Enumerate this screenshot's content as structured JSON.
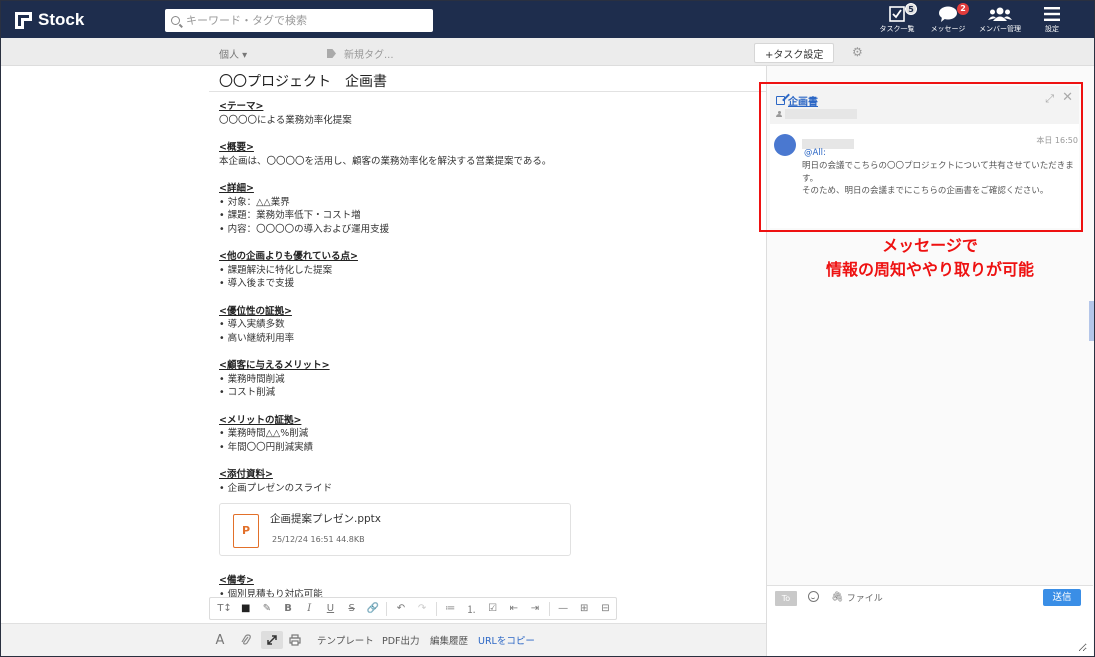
{
  "header": {
    "app_name": "Stock",
    "search_placeholder": "キーワード・タグで検索",
    "nav": [
      {
        "label": "タスク一覧",
        "badge": "5"
      },
      {
        "label": "メッセージ",
        "badge": "2"
      },
      {
        "label": "メンバー管理"
      },
      {
        "label": "設定"
      }
    ]
  },
  "subbar": {
    "scope": "個人 ▾",
    "tag_placeholder": "新規タグ...",
    "task_button": "+タスク設定"
  },
  "document": {
    "title": "〇〇プロジェクト　企画書",
    "sections": [
      {
        "heading": "<テーマ>",
        "lines": [
          "〇〇〇〇による業務効率化提案"
        ]
      },
      {
        "heading": "<概要>",
        "lines": [
          "本企画は、〇〇〇〇を活用し、顧客の業務効率化を解決する営業提案である。"
        ]
      },
      {
        "heading": "<詳細>",
        "bullets": [
          "対象：△△業界",
          "課題：業務効率低下・コスト増",
          "内容：〇〇〇〇の導入および運用支援"
        ]
      },
      {
        "heading": "<他の企画よりも優れている点>",
        "bullets": [
          "課題解決に特化した提案",
          "導入後まで支援"
        ]
      },
      {
        "heading": "<優位性の証拠>",
        "bullets": [
          "導入実績多数",
          "高い継続利用率"
        ]
      },
      {
        "heading": "<顧客に与えるメリット>",
        "bullets": [
          "業務時間削減",
          "コスト削減"
        ]
      },
      {
        "heading": "<メリットの証拠>",
        "bullets": [
          "業務時間△△%削減",
          "年間〇〇円削減実績"
        ]
      },
      {
        "heading": "<添付資料>",
        "bullets": [
          "企画プレゼンのスライド"
        ]
      },
      {
        "heading": "<備考>",
        "bullets": [
          "個別見積もり対応可能"
        ]
      }
    ],
    "attachment": {
      "icon_letter": "P",
      "name": "企画提案プレゼン.pptx",
      "meta": "25/12/24 16:51   44.8KB"
    }
  },
  "format_toolbar": [
    "T↕",
    "■",
    "✎",
    "B",
    "I",
    "U",
    "S",
    "🔗",
    "↶",
    "↷",
    "≔",
    "⒈",
    "☑",
    "⇤",
    "⇥",
    "—",
    "⊞",
    "⊟"
  ],
  "bottombar": {
    "font_label": "A",
    "template": "テンプレート",
    "pdf": "PDF出力",
    "history": "編集履歴",
    "copy_url": "URLをコピー"
  },
  "message": {
    "title": "企画書",
    "time": "本日 16:50",
    "mention": "@All:",
    "lines": [
      "明日の会議でこちらの〇〇プロジェクトについて共有させていただきます。",
      "そのため、明日の会議までにこちらの企画書をご確認ください。"
    ],
    "avatar_color": "#4a78d0"
  },
  "callout": {
    "line1": "メッセージで",
    "line2": "情報の周知ややり取りが可能",
    "color": "#ee1111"
  },
  "composer": {
    "to_label": "To",
    "file_label": "ファイル",
    "send_label": "送信"
  }
}
